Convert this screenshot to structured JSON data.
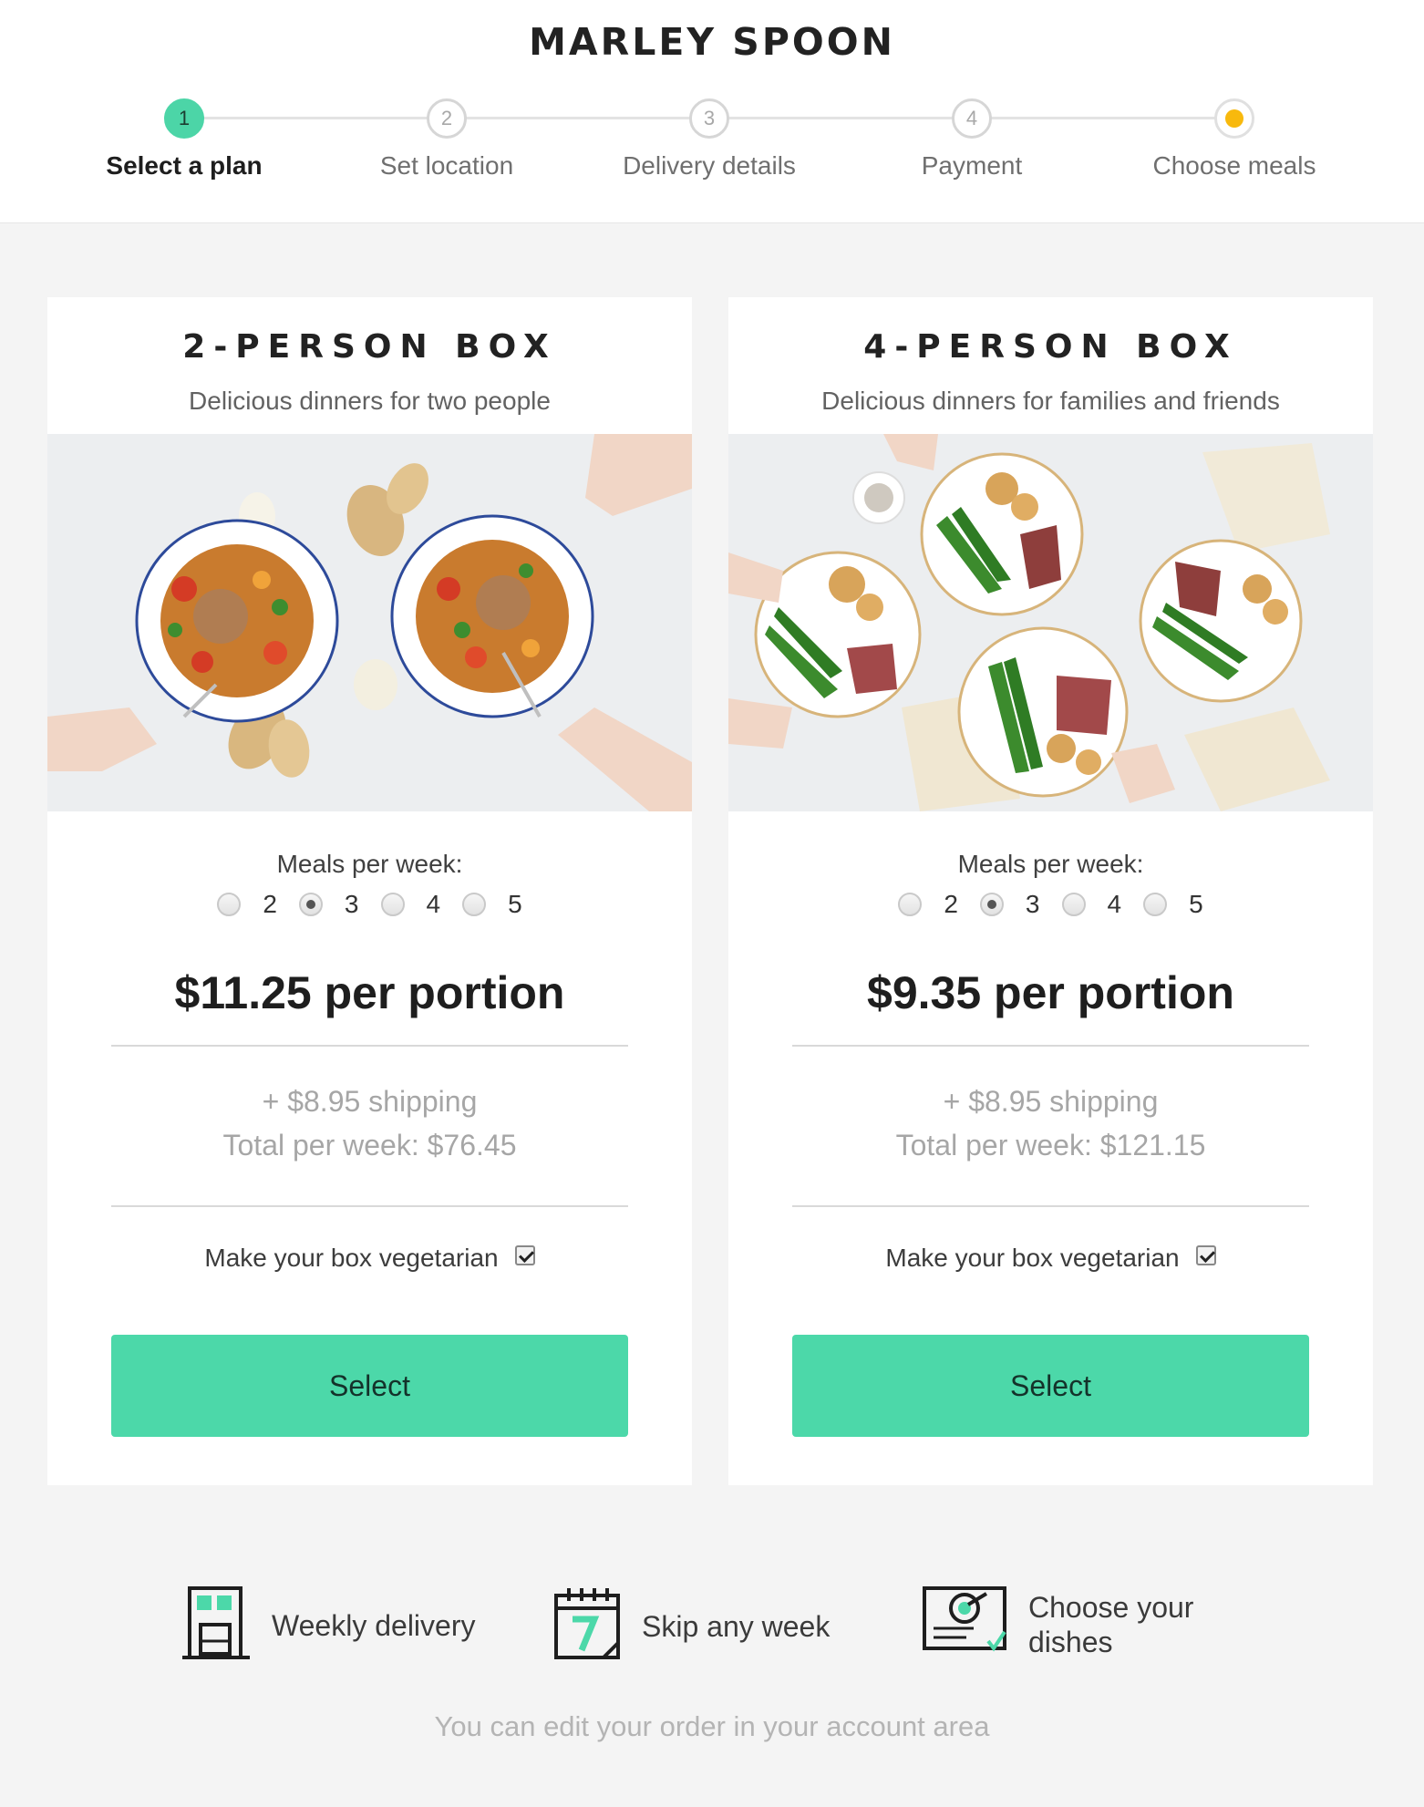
{
  "brand": {
    "logo_text": "MARLEY SPOON"
  },
  "steps": [
    {
      "number": "1",
      "label": "Select a plan",
      "state": "active"
    },
    {
      "number": "2",
      "label": "Set location",
      "state": "upcoming"
    },
    {
      "number": "3",
      "label": "Delivery details",
      "state": "upcoming"
    },
    {
      "number": "4",
      "label": "Payment",
      "state": "upcoming"
    },
    {
      "number": "",
      "label": "Choose meals",
      "state": "final"
    }
  ],
  "plans": [
    {
      "title": "2-PERSON BOX",
      "subtitle": "Delicious dinners for two people",
      "meals_label": "Meals per week:",
      "meal_options": [
        "2",
        "3",
        "4",
        "5"
      ],
      "selected_meals": "3",
      "price": "$11.25 per portion",
      "shipping": "+ $8.95 shipping",
      "total": "Total per week: $76.45",
      "vegetarian_label": "Make your box vegetarian",
      "vegetarian_checked": true,
      "button_label": "Select"
    },
    {
      "title": "4-PERSON BOX",
      "subtitle": "Delicious dinners for families and friends",
      "meals_label": "Meals per week:",
      "meal_options": [
        "2",
        "3",
        "4",
        "5"
      ],
      "selected_meals": "3",
      "price": "$9.35 per portion",
      "shipping": "+ $8.95 shipping",
      "total": "Total per week: $121.15",
      "vegetarian_label": "Make your box vegetarian",
      "vegetarian_checked": true,
      "button_label": "Select"
    }
  ],
  "features": [
    {
      "icon": "delivery-box-icon",
      "label": "Weekly delivery"
    },
    {
      "icon": "calendar-icon",
      "label": "Skip any week"
    },
    {
      "icon": "dish-menu-icon",
      "label": "Choose your dishes"
    }
  ],
  "footer_note": "You can edit your order in your account area",
  "colors": {
    "accent": "#4cd8a9",
    "step_active": "#4cd5a7",
    "step_final_dot": "#f8b90d",
    "page_bg": "#f4f4f4"
  }
}
